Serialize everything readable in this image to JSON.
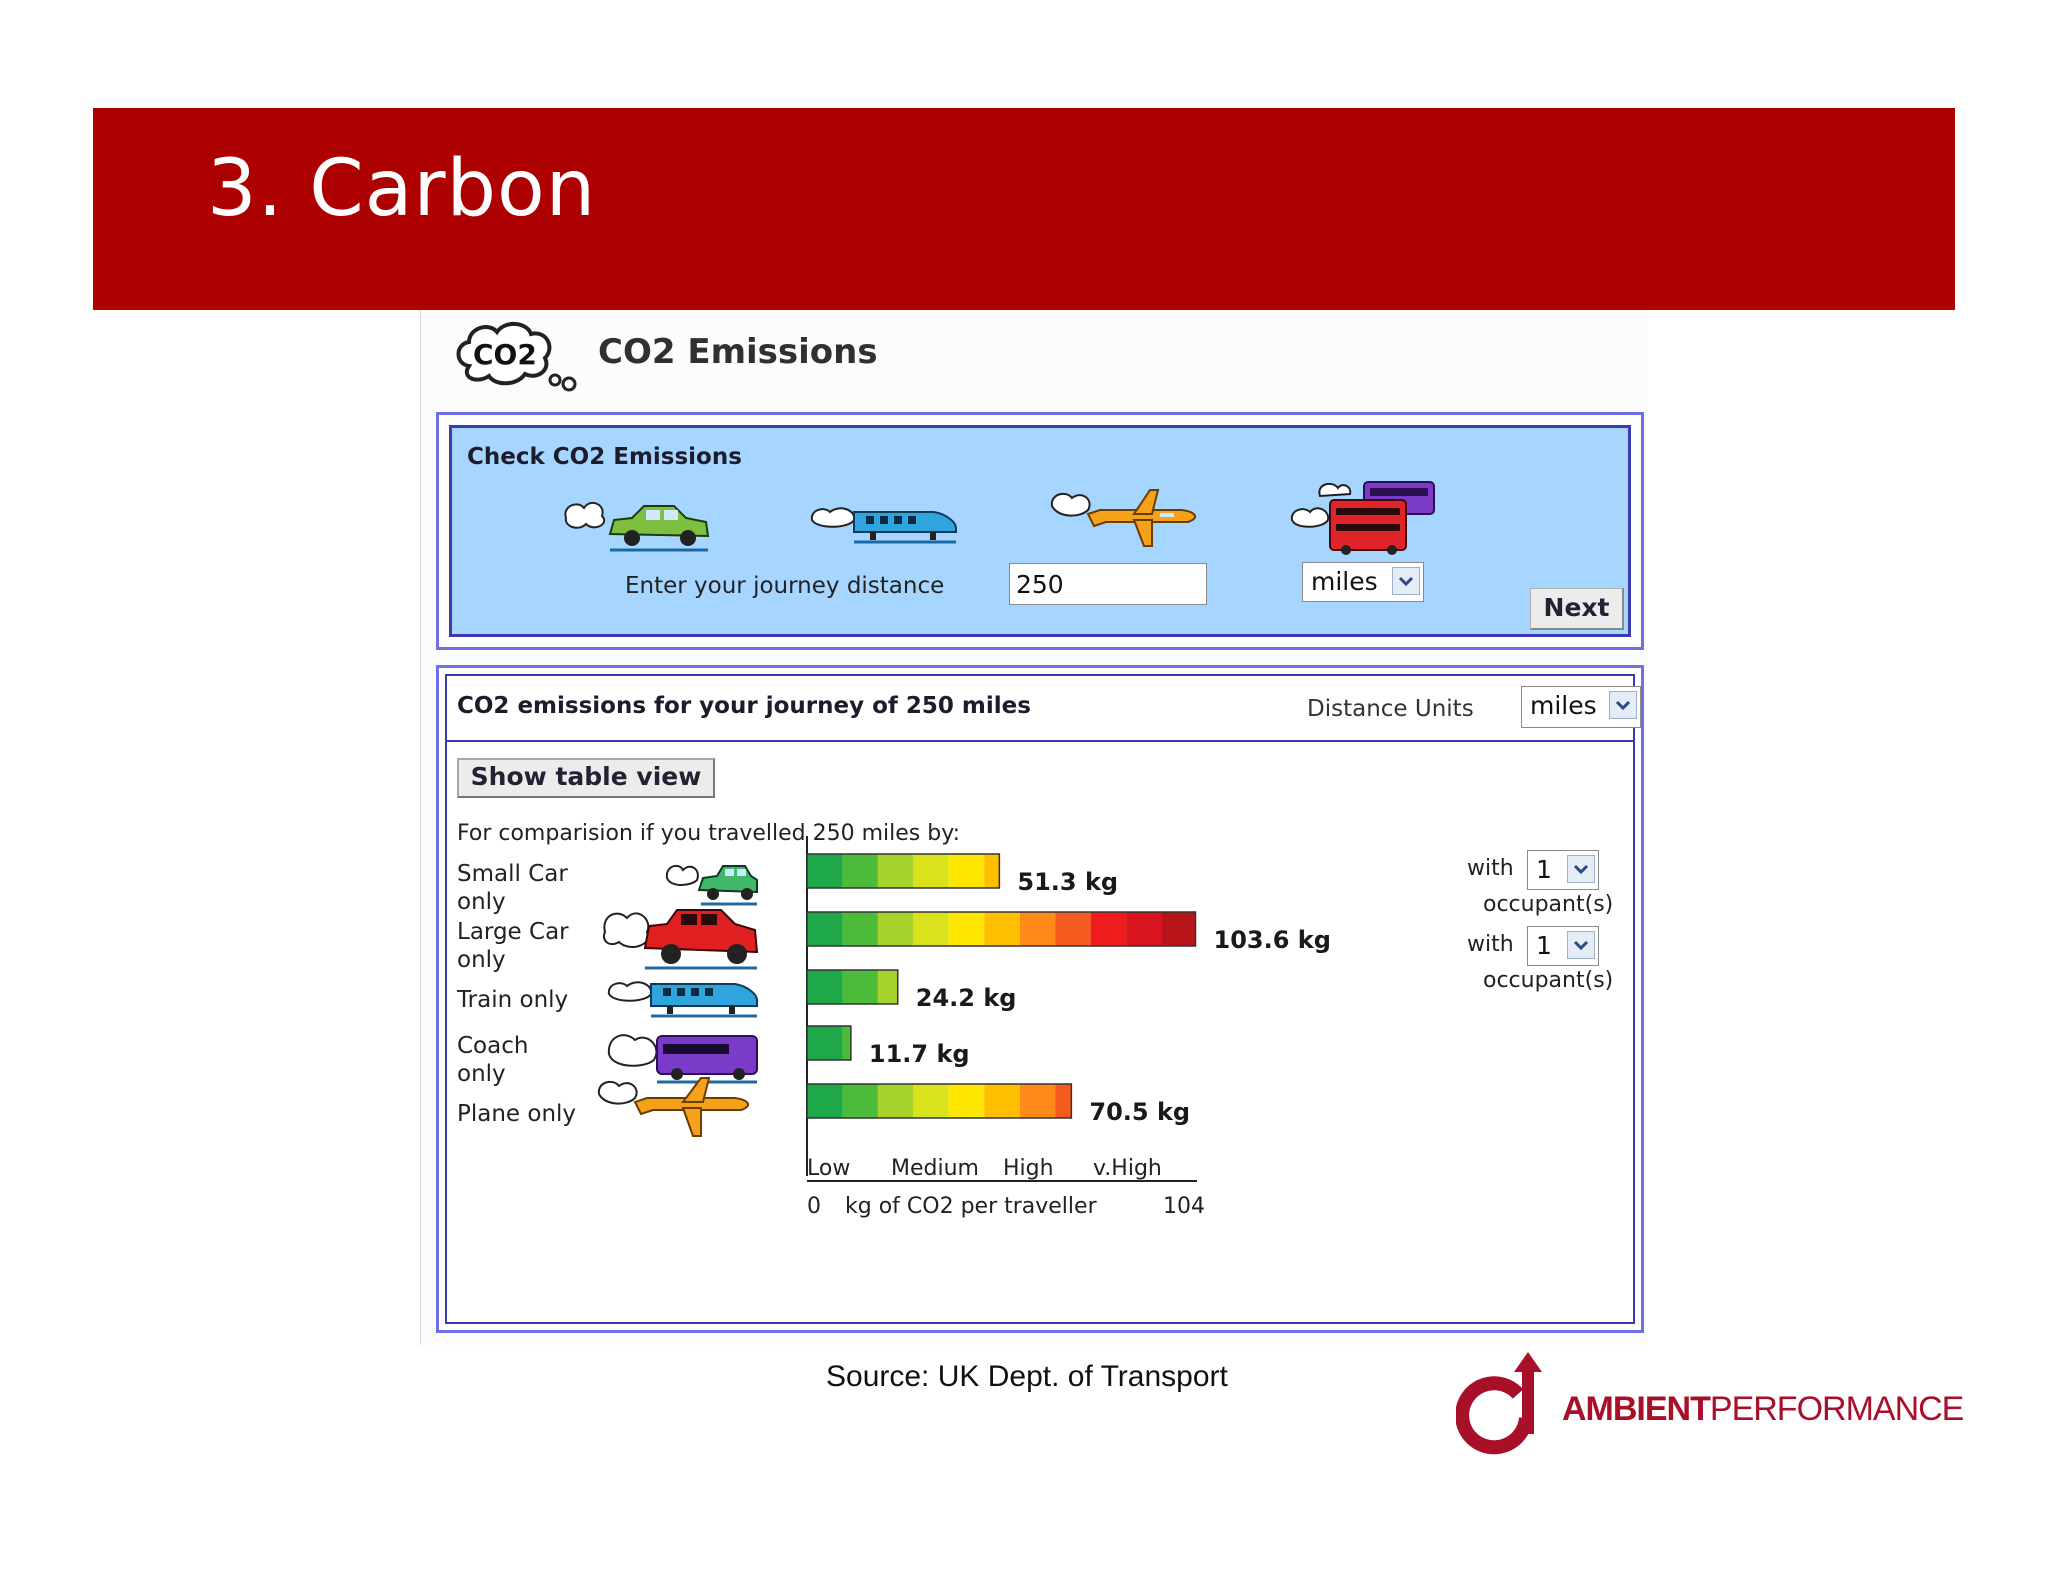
{
  "slide": {
    "title": "3. Carbon",
    "source": "Source: UK Dept. of Transport",
    "logo_bold": "AMBIENT",
    "logo_light": "PERFORMANCE",
    "banner_color": "#ad0000",
    "logo_color": "#a8102a"
  },
  "widget": {
    "logo_text": "CO2",
    "title": "CO2 Emissions"
  },
  "check_panel": {
    "heading": "Check CO2 Emissions",
    "modes": [
      "car-icon",
      "train-icon",
      "plane-icon",
      "bus-icon"
    ],
    "journey_label": "Enter your journey distance",
    "distance_value": "250",
    "unit_selected": "miles",
    "next_label": "Next"
  },
  "results": {
    "title": "CO2 emissions for your journey of 250 miles",
    "units_label": "Distance Units",
    "units_selected": "miles",
    "table_view_label": "Show table view",
    "compare_label": "For comparision if you travelled 250 miles by:",
    "rows": [
      {
        "label": "Small Car only",
        "value_label": "51.3 kg",
        "icon": "small-car-icon",
        "with": "with",
        "occupants": "1",
        "occupants_label": "occupant(s)"
      },
      {
        "label": "Large Car only",
        "value_label": "103.6 kg",
        "icon": "large-car-icon",
        "with": "with",
        "occupants": "1",
        "occupants_label": "occupant(s)"
      },
      {
        "label": "Train only",
        "value_label": "24.2 kg",
        "icon": "train-icon"
      },
      {
        "label": "Coach only",
        "value_label": "11.7 kg",
        "icon": "coach-icon"
      },
      {
        "label": "Plane only",
        "value_label": "70.5 kg",
        "icon": "plane-icon"
      }
    ],
    "scale_words": [
      "Low",
      "Medium",
      "High",
      "v.High"
    ],
    "axis_min": "0",
    "axis_caption": "kg of CO2 per traveller",
    "axis_max": "104"
  },
  "chart_data": {
    "type": "bar",
    "categories": [
      "Small Car only",
      "Large Car only",
      "Train only",
      "Coach only",
      "Plane only"
    ],
    "values": [
      51.3,
      103.6,
      24.2,
      11.7,
      70.5
    ],
    "xlabel": "kg of CO2 per traveller",
    "xlim": [
      0,
      104
    ],
    "gradient": [
      "#1fa84a",
      "#4cbb3a",
      "#a6d22e",
      "#d9e21a",
      "#ffe600",
      "#ffbf00",
      "#ff8a1a",
      "#f55a1e",
      "#ee1c1c",
      "#d8141e",
      "#b8141a"
    ]
  }
}
